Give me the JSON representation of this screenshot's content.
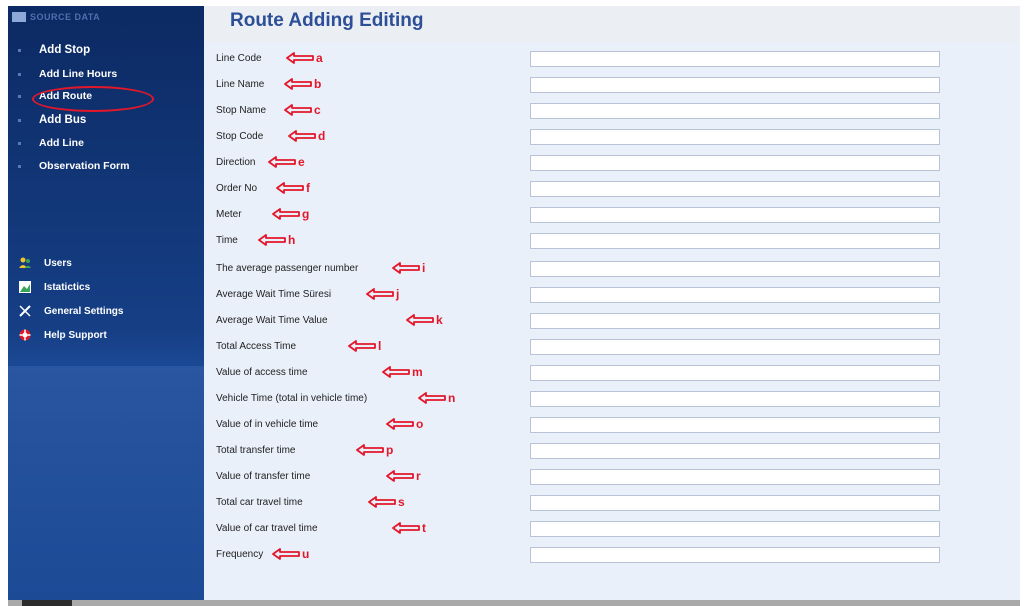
{
  "sidebar": {
    "section_title": "SOURCE DATA",
    "items": [
      {
        "label": "Add Stop",
        "name": "sidebar-item-add-stop"
      },
      {
        "label": "Add Line Hours",
        "name": "sidebar-item-add-line-hours"
      },
      {
        "label": "Add Route",
        "name": "sidebar-item-add-route"
      },
      {
        "label": "Add Bus",
        "name": "sidebar-item-add-bus"
      },
      {
        "label": "Add Line",
        "name": "sidebar-item-add-line"
      },
      {
        "label": "Observation Form",
        "name": "sidebar-item-observation-form"
      }
    ],
    "tools": [
      {
        "label": "Users",
        "icon": "users-icon"
      },
      {
        "label": "Istatictics",
        "icon": "statistics-icon"
      },
      {
        "label": "General Settings",
        "icon": "tools-icon"
      },
      {
        "label": "Help Support",
        "icon": "lifebuoy-icon"
      }
    ]
  },
  "main": {
    "title": "Route Adding Editing",
    "fields": [
      {
        "label": "Line Code",
        "marker": "a"
      },
      {
        "label": "Line Name",
        "marker": "b"
      },
      {
        "label": "Stop Name",
        "marker": "c"
      },
      {
        "label": "Stop Code",
        "marker": "d"
      },
      {
        "label": "Direction",
        "marker": "e"
      },
      {
        "label": "Order No",
        "marker": "f"
      },
      {
        "label": "Meter",
        "marker": "g"
      },
      {
        "label": "Time",
        "marker": "h"
      },
      {
        "label": "The average passenger number",
        "marker": "i"
      },
      {
        "label": "Average Wait Time Süresi",
        "marker": "j"
      },
      {
        "label": "Average Wait Time Value",
        "marker": "k"
      },
      {
        "label": "Total Access Time",
        "marker": "l"
      },
      {
        "label": "Value of access time",
        "marker": "m"
      },
      {
        "label": "Vehicle Time (total in vehicle time)",
        "marker": "n"
      },
      {
        "label": "Value of in vehicle time",
        "marker": "o"
      },
      {
        "label": "Total transfer time",
        "marker": "p"
      },
      {
        "label": "Value of transfer time",
        "marker": "r"
      },
      {
        "label": "Total car travel time",
        "marker": "s"
      },
      {
        "label": "Value of car travel time",
        "marker": "t"
      },
      {
        "label": "Frequency",
        "marker": "u"
      }
    ]
  },
  "colors": {
    "accent": "#2c4f98",
    "annotation": "#e3172a",
    "sidebar": "#0c2a63",
    "main_background": "#e9f0fa"
  }
}
